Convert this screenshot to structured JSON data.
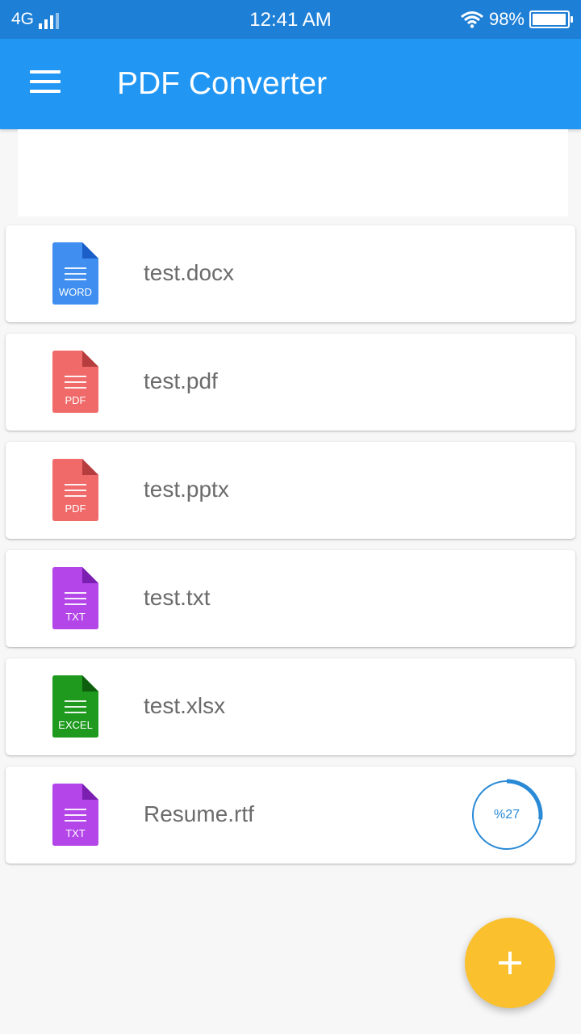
{
  "status_bar": {
    "network": "4G",
    "time": "12:41 AM",
    "battery": "98%",
    "battery_level": 0.98,
    "icons": [
      "signal-icon",
      "wifi-icon",
      "battery-icon"
    ]
  },
  "app_bar": {
    "title": "PDF Converter",
    "menu_icon": "hamburger-menu-icon",
    "color": "#2196f3"
  },
  "files": [
    {
      "name": "test.docx",
      "type_label": "WORD",
      "color": "#3f8ef0",
      "fold_color": "#1c5ec8"
    },
    {
      "name": "test.pdf",
      "type_label": "PDF",
      "color": "#f06a6a",
      "fold_color": "#b63d3d"
    },
    {
      "name": "test.pptx",
      "type_label": "PDF",
      "color": "#f06a6a",
      "fold_color": "#b63d3d"
    },
    {
      "name": "test.txt",
      "type_label": "TXT",
      "color": "#b445e8",
      "fold_color": "#7a1fb0"
    },
    {
      "name": "test.xlsx",
      "type_label": "EXCEL",
      "color": "#1f9a1f",
      "fold_color": "#0d5e0d"
    },
    {
      "name": "Resume.rtf",
      "type_label": "TXT",
      "color": "#b445e8",
      "fold_color": "#7a1fb0",
      "progress_label": "%27",
      "progress": 0.27
    }
  ],
  "fab": {
    "icon": "plus-icon",
    "color": "#fbc02d"
  },
  "accent_color": "#2a8ad6"
}
